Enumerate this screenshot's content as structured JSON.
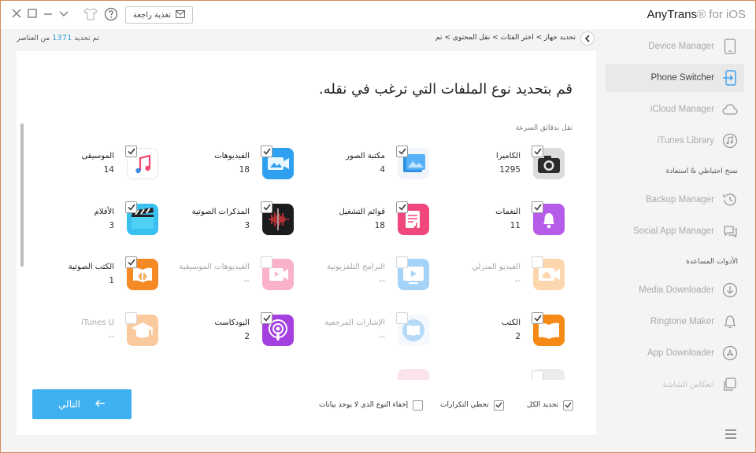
{
  "window": {
    "feedback_label": "تغذية راجعة",
    "brand_name": "AnyTrans",
    "brand_suffix": "® for iOS"
  },
  "status": {
    "counter_prefix": "تم تحديد",
    "counter_value": "1371",
    "counter_suffix": "من العناصر",
    "breadcrumb": "تحديد جهاز > اختر الفئات > نقل المحتوى > تم"
  },
  "sidebar": {
    "items": [
      {
        "label": "Device Manager",
        "icon": "device-icon",
        "active": false
      },
      {
        "label": "Phone Switcher",
        "icon": "phone-switch-icon",
        "active": true
      },
      {
        "label": "iCloud Manager",
        "icon": "cloud-icon",
        "active": false
      },
      {
        "label": "iTunes Library",
        "icon": "music-note-icon",
        "active": false
      },
      {
        "label": "Backup Manager",
        "icon": "history-icon",
        "active": false
      },
      {
        "label": "Social App Manager",
        "icon": "chat-icon",
        "active": false
      },
      {
        "label": "Media Downloader",
        "icon": "download-icon",
        "active": false
      },
      {
        "label": "Ringtone Maker",
        "icon": "bell-icon",
        "active": false
      },
      {
        "label": "App Downloader",
        "icon": "app-store-icon",
        "active": false
      },
      {
        "label": "انعكاس الشاشة",
        "icon": "screen-mirror-icon",
        "active": false
      }
    ],
    "sections": [
      "نسخ احتياطي & استعادة",
      "الأدوات المساعدة"
    ]
  },
  "main": {
    "heading": "قم بتحديد نوع الملفات التي ترغب في نقله.",
    "subheading": "نقل بدقائق السرعة",
    "categories": [
      {
        "name": "الكاميرا",
        "count": "1295",
        "checked": true,
        "disabled": false,
        "icon": "camera-icon"
      },
      {
        "name": "مكتبة الصور",
        "count": "4",
        "checked": true,
        "disabled": false,
        "icon": "photo-library-icon"
      },
      {
        "name": "الفيديوهات",
        "count": "18",
        "checked": true,
        "disabled": false,
        "icon": "video-icon"
      },
      {
        "name": "الموسيقى",
        "count": "14",
        "checked": true,
        "disabled": false,
        "icon": "music-icon"
      },
      {
        "name": "النغمات",
        "count": "11",
        "checked": true,
        "disabled": false,
        "icon": "ringtone-icon"
      },
      {
        "name": "قوائم التشغيل",
        "count": "18",
        "checked": true,
        "disabled": false,
        "icon": "playlist-icon"
      },
      {
        "name": "المذكرات الصوتية",
        "count": "3",
        "checked": true,
        "disabled": false,
        "icon": "voice-memo-icon"
      },
      {
        "name": "الأفلام",
        "count": "3",
        "checked": true,
        "disabled": false,
        "icon": "movies-icon"
      },
      {
        "name": "الفيديو المنزلي",
        "count": "--",
        "checked": false,
        "disabled": true,
        "icon": "home-video-icon"
      },
      {
        "name": "البرامج التلفزيونية",
        "count": "--",
        "checked": false,
        "disabled": true,
        "icon": "tv-shows-icon"
      },
      {
        "name": "الفيديوهات الموسيقية",
        "count": "--",
        "checked": false,
        "disabled": true,
        "icon": "music-video-icon"
      },
      {
        "name": "الكتب الصوتية",
        "count": "1",
        "checked": true,
        "disabled": false,
        "icon": "audiobook-icon"
      },
      {
        "name": "الكتب",
        "count": "2",
        "checked": true,
        "disabled": false,
        "icon": "books-icon"
      },
      {
        "name": "الإشارات المرجعية",
        "count": "--",
        "checked": false,
        "disabled": true,
        "icon": "bookmark-icon"
      },
      {
        "name": "البودكاست",
        "count": "2",
        "checked": true,
        "disabled": false,
        "icon": "podcast-icon"
      },
      {
        "name": "iTunes U",
        "count": "--",
        "checked": false,
        "disabled": true,
        "icon": "itunes-u-icon"
      }
    ],
    "options": {
      "select_all": "تحديد الكل",
      "skip_duplicates": "تخطي التكرارات",
      "hide_empty": "إخفاء النوع الذي لا يوجد بيانات"
    },
    "next_label": "التالي"
  }
}
